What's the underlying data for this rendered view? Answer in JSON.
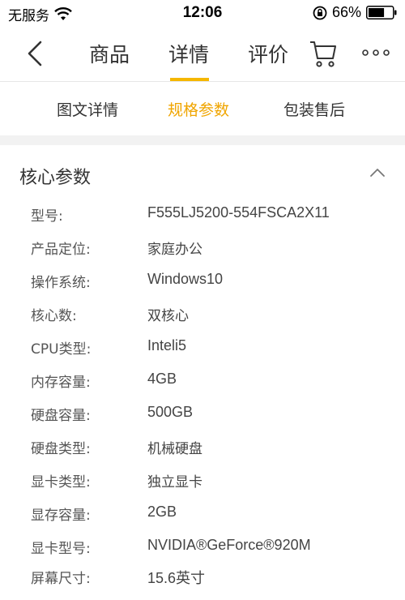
{
  "status_bar": {
    "carrier": "无服务",
    "time": "12:06",
    "battery_text": "66%",
    "battery_level": 0.66
  },
  "nav": {
    "tabs": [
      {
        "label": "商品"
      },
      {
        "label": "详情"
      },
      {
        "label": "评价"
      }
    ],
    "active_tab": "详情",
    "accent_color": "#f5b700"
  },
  "sub_tabs": {
    "items": [
      {
        "label": "图文详情"
      },
      {
        "label": "规格参数"
      },
      {
        "label": "包装售后"
      }
    ],
    "active": "规格参数",
    "active_color": "#f0a500"
  },
  "section": {
    "title": "核心参数",
    "params": [
      {
        "label": "型号:",
        "value": "F555LJ5200-554FSCA2X11"
      },
      {
        "label": "产品定位:",
        "value": "家庭办公"
      },
      {
        "label": "操作系统:",
        "value": "Windows10"
      },
      {
        "label": "核心数:",
        "value": "双核心"
      },
      {
        "label": "CPU类型:",
        "value": "Inteli5"
      },
      {
        "label": "内存容量:",
        "value": "4GB"
      },
      {
        "label": "硬盘容量:",
        "value": "500GB"
      },
      {
        "label": "硬盘类型:",
        "value": "机械硬盘"
      },
      {
        "label": "显卡类型:",
        "value": "独立显卡"
      },
      {
        "label": "显存容量:",
        "value": "2GB"
      },
      {
        "label": "显卡型号:",
        "value": "NVIDIA®GeForce®920M"
      },
      {
        "label": "屏幕尺寸:",
        "value": "15.6英寸"
      }
    ]
  }
}
